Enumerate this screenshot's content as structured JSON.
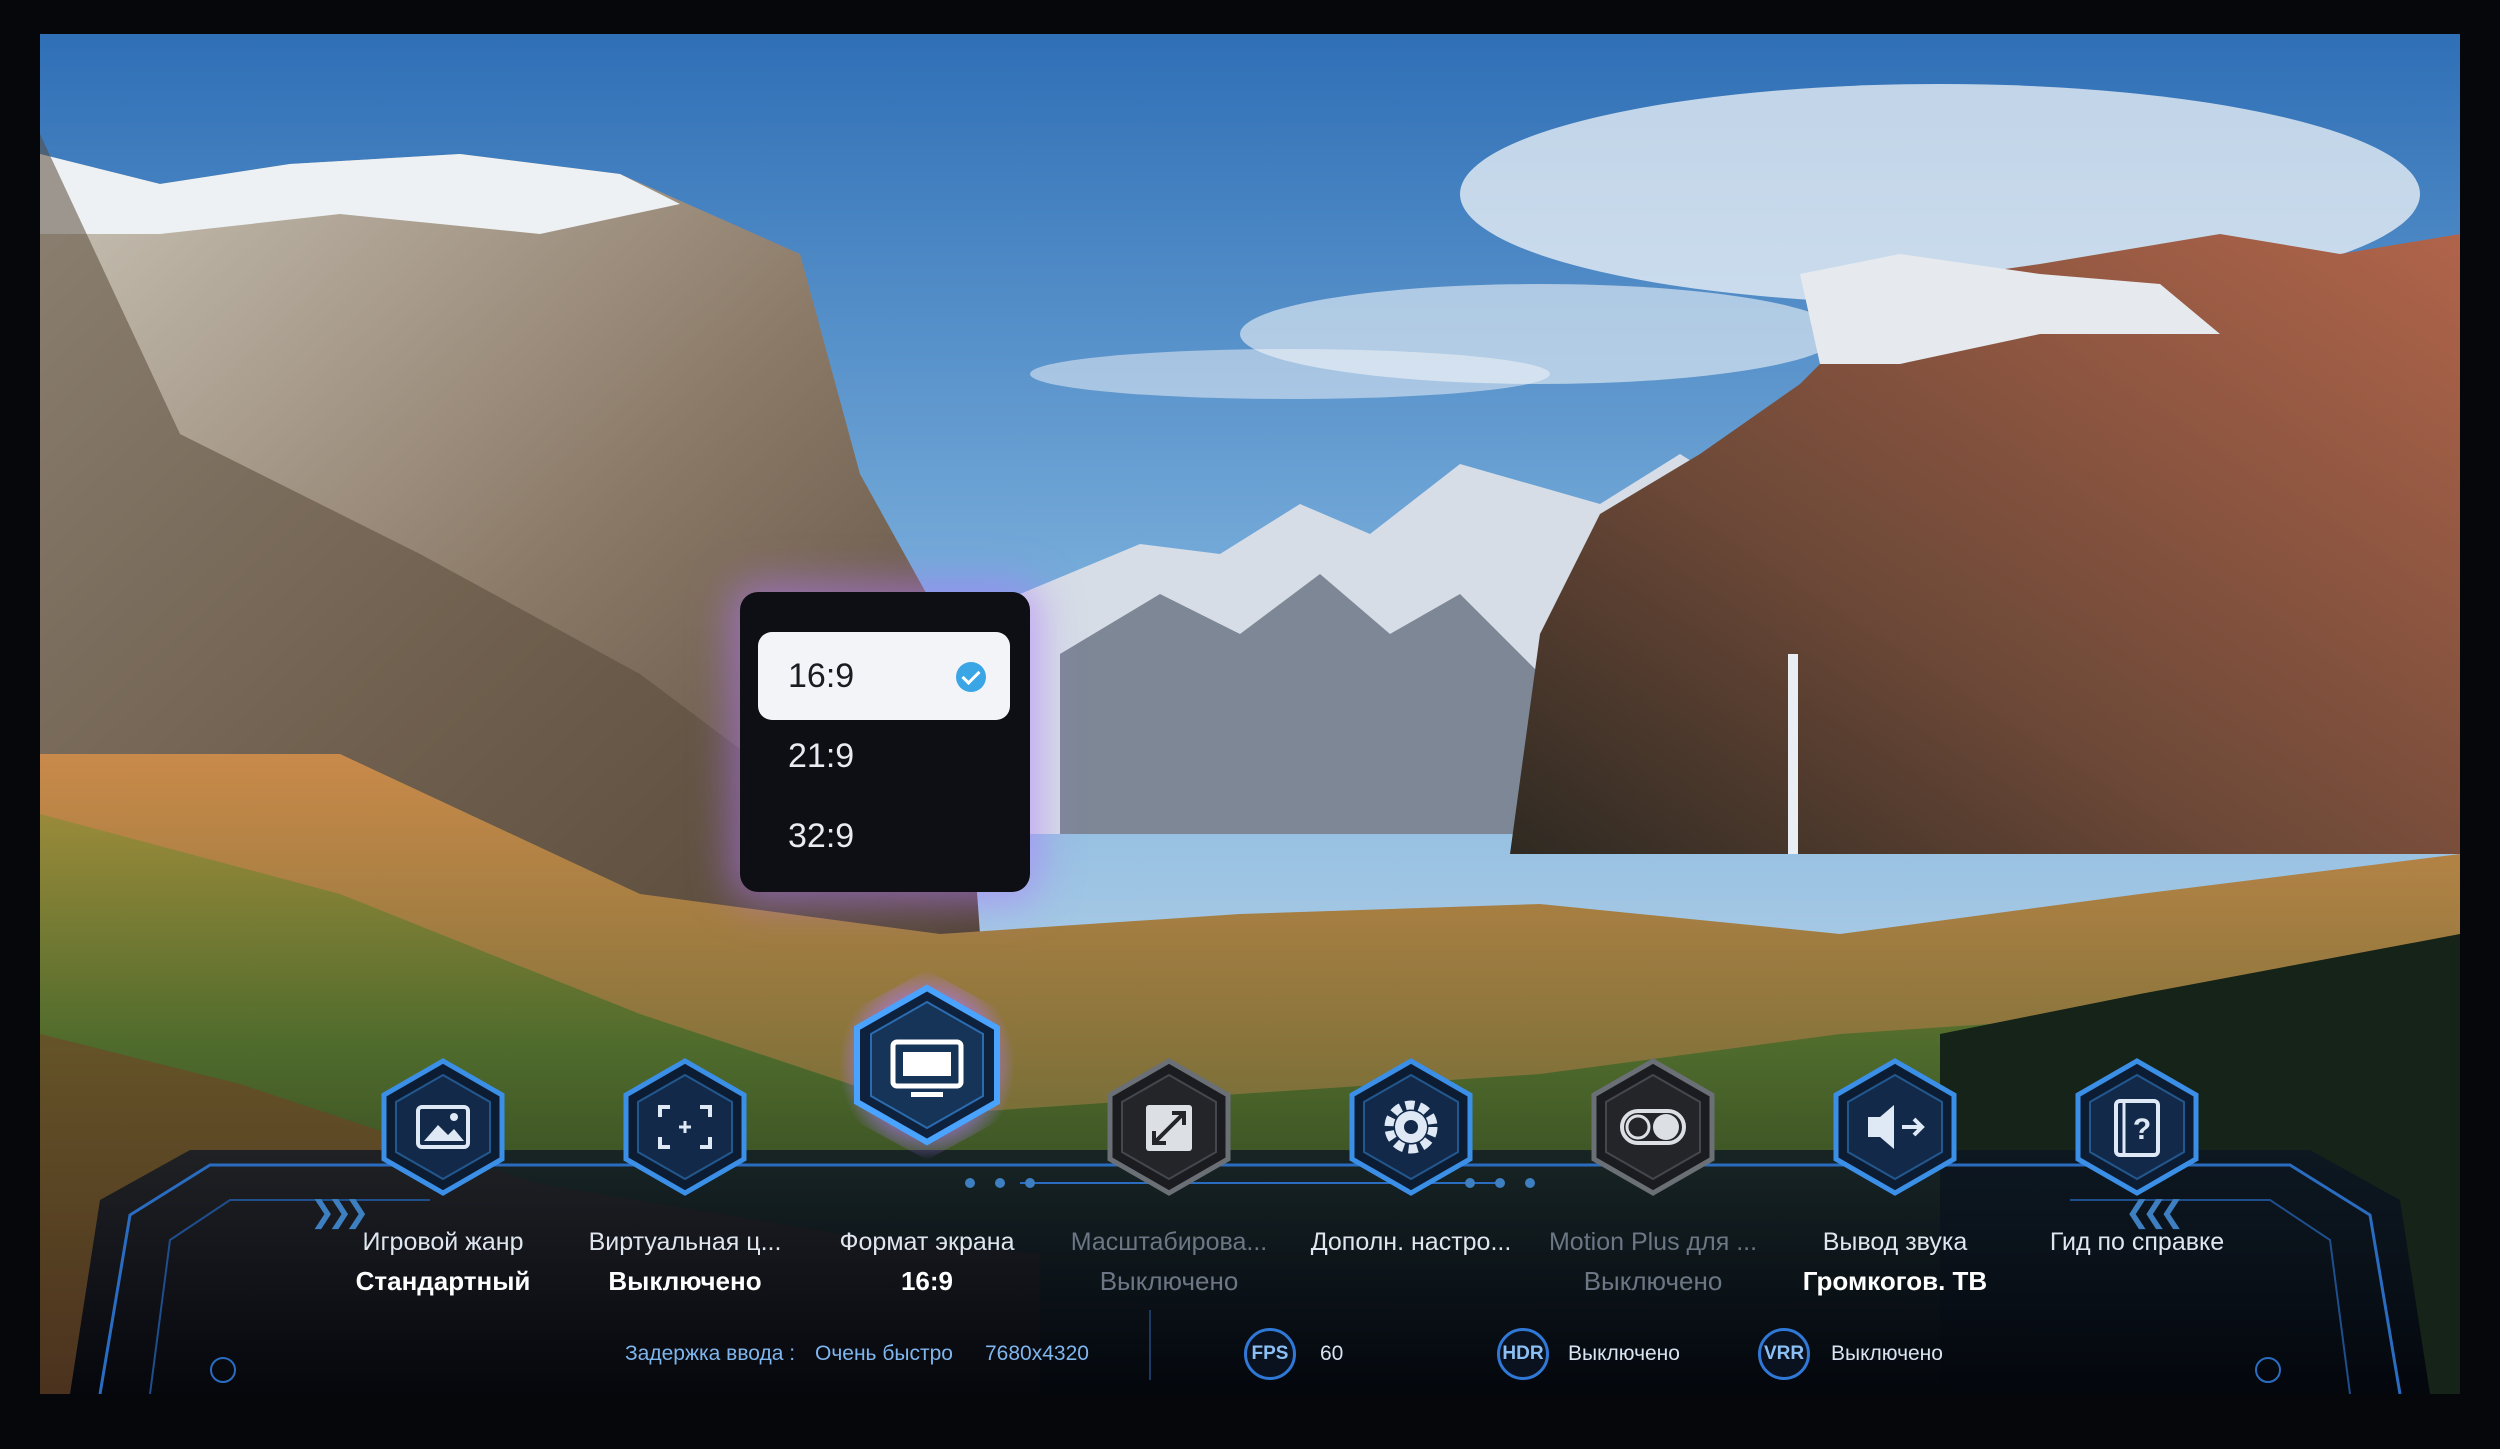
{
  "aspect_popup": {
    "options": [
      {
        "label": "16:9",
        "selected": true
      },
      {
        "label": "21:9",
        "selected": false
      },
      {
        "label": "32:9",
        "selected": false
      }
    ]
  },
  "game_bar": {
    "tiles": [
      {
        "name": "Игровой жанр",
        "value": "Стандартный",
        "icon": "picture-icon",
        "enabled": true
      },
      {
        "name": "Виртуальная ц...",
        "value": "Выключено",
        "icon": "crosshair-icon",
        "enabled": true
      },
      {
        "name": "Формат экрана",
        "value": "16:9",
        "icon": "screen-icon",
        "enabled": true,
        "focused": true
      },
      {
        "name": "Масштабирова...",
        "value": "Выключено",
        "icon": "expand-icon",
        "enabled": false
      },
      {
        "name": "Дополн. настро...",
        "value": "",
        "icon": "gear-icon",
        "enabled": true
      },
      {
        "name": "Motion Plus для ...",
        "value": "Выключено",
        "icon": "toggle-icon",
        "enabled": false
      },
      {
        "name": "Вывод звука",
        "value": "Громкогов. ТВ",
        "icon": "speaker-icon",
        "enabled": true
      },
      {
        "name": "Гид по справке",
        "value": "",
        "icon": "help-book-icon",
        "enabled": true
      }
    ],
    "status": {
      "input_lag_label": "Задержка ввода :",
      "input_lag_value": "Очень быстро",
      "resolution": "7680x4320",
      "fps_badge": "FPS",
      "fps_value": "60",
      "hdr_badge": "HDR",
      "hdr_value": "Выключено",
      "vrr_badge": "VRR",
      "vrr_value": "Выключено"
    },
    "colors": {
      "accent": "#3aa6e6",
      "focus_glow": "#b078ff",
      "frame_blue": "#2a6cc0"
    }
  }
}
